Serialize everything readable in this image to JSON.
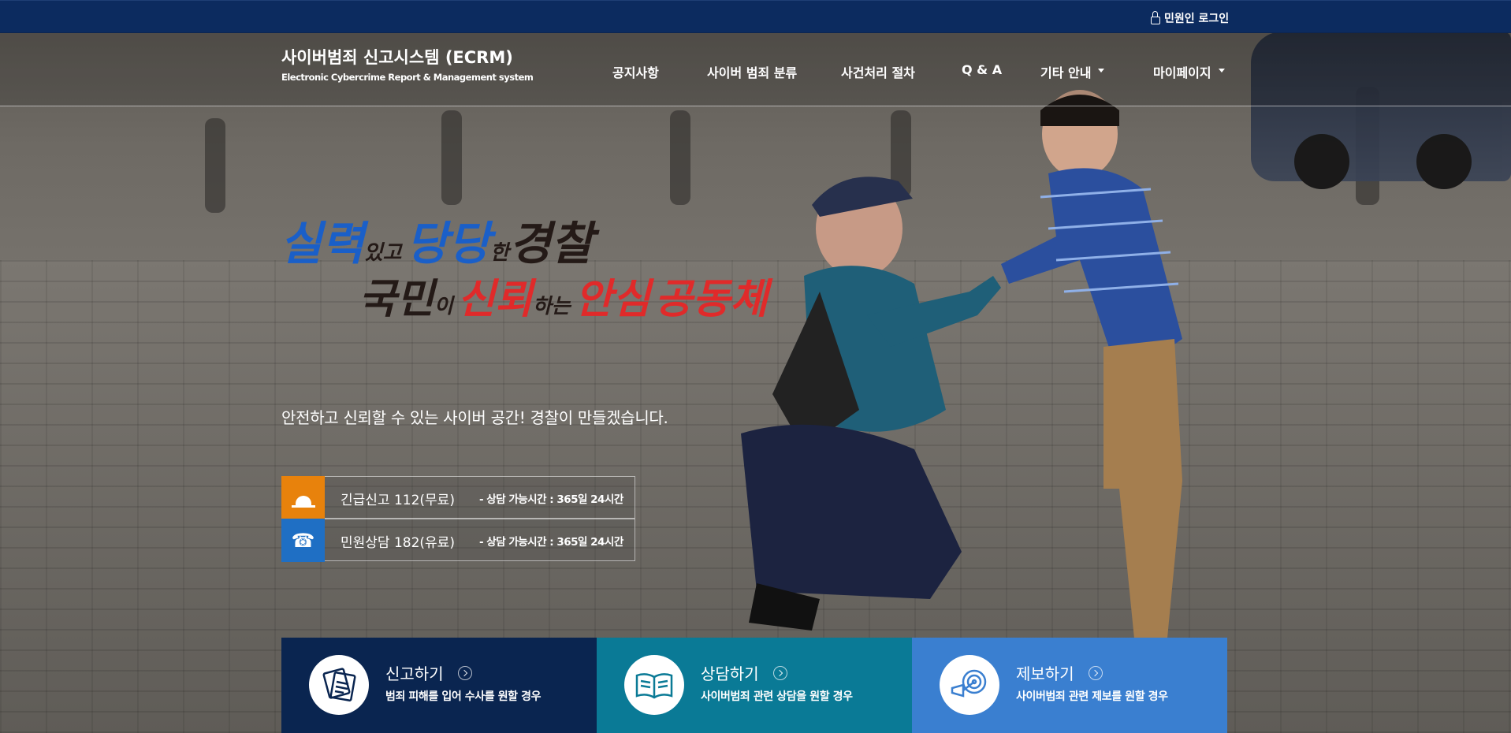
{
  "topbar": {
    "login_label": "민원인 로그인"
  },
  "header": {
    "title": "사이버범죄 신고시스템 (ECRM)",
    "subtitle": "Electronic Cybercrime Report & Management system",
    "nav": [
      {
        "label": "공지사항",
        "dropdown": false
      },
      {
        "label": "사이버 범죄 분류",
        "dropdown": false
      },
      {
        "label": "사건처리 절차",
        "dropdown": false
      },
      {
        "label": "Q & A",
        "dropdown": false
      },
      {
        "label": "기타 안내",
        "dropdown": true
      },
      {
        "label": "마이페이지",
        "dropdown": true
      }
    ]
  },
  "slogan": {
    "line1": [
      "실력",
      "있고",
      "당당",
      "한",
      "경찰"
    ],
    "line2": [
      "국민",
      "이",
      "신뢰",
      "하는",
      "안심",
      "공동체"
    ]
  },
  "tagline": "안전하고 신뢰할 수 있는 사이버 공간! 경찰이 만들겠습니다.",
  "contacts": [
    {
      "label": "긴급신고 112(무료)",
      "hours": "- 상담 가능시간 : 365일 24시간",
      "icon": "siren-icon",
      "color": "#e8820c"
    },
    {
      "label": "민원상담 182(유료)",
      "hours": "- 상담 가능시간 : 365일 24시간",
      "icon": "phone-icon",
      "color": "#1f6fc4"
    }
  ],
  "cards": [
    {
      "title": "신고하기",
      "desc": "범죄 피해를 입어 수사를 원할 경우",
      "icon": "report-document-icon",
      "color": "#0a2550"
    },
    {
      "title": "상담하기",
      "desc": "사이버범죄 관련 상담을 원할 경우",
      "icon": "open-book-icon",
      "color": "#0a7a96"
    },
    {
      "title": "제보하기",
      "desc": "사이버범죄 관련 제보를 원할 경우",
      "icon": "megaphone-target-icon",
      "color": "#3a7fd0"
    }
  ]
}
